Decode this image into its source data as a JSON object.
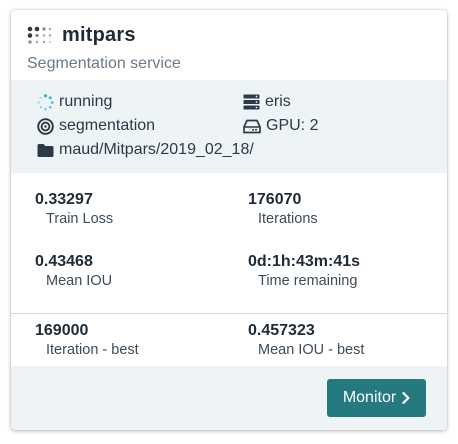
{
  "card": {
    "title": "mitpars",
    "subtitle": "Segmentation service",
    "status": "running",
    "host": "eris",
    "task": "segmentation",
    "gpu": "GPU: 2",
    "path": "maud/Mitpars/2019_02_18/",
    "icons": {
      "logo": "dots-grid-logo",
      "status": "spinner-icon",
      "host": "server-icon",
      "task": "target-icon",
      "gpu": "hard-drive-icon",
      "path": "folder-icon"
    }
  },
  "metrics": [
    {
      "value": "0.33297",
      "label": "Train Loss"
    },
    {
      "value": "176070",
      "label": "Iterations"
    },
    {
      "value": "0.43468",
      "label": "Mean IOU"
    },
    {
      "value": "0d:1h:43m:41s",
      "label": "Time remaining"
    }
  ],
  "best": [
    {
      "value": "169000",
      "label": "Iteration - best"
    },
    {
      "value": "0.457323",
      "label": "Mean IOU - best"
    }
  ],
  "footer": {
    "monitor_label": "Monitor",
    "accent_color": "#257a80"
  }
}
